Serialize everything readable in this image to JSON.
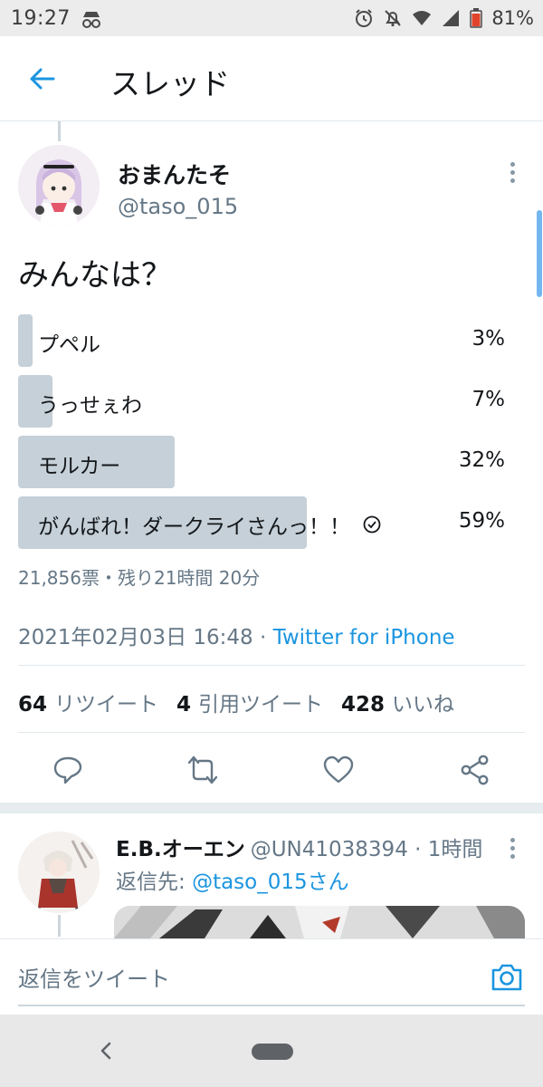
{
  "status_bar": {
    "time": "19:27",
    "battery_percent": "81%",
    "icons": [
      "incognito-icon",
      "alarm-icon",
      "notifications-off-icon",
      "wifi-icon",
      "signal-icon",
      "battery-icon"
    ]
  },
  "header": {
    "title": "スレッド",
    "back_icon": "arrow-left-icon"
  },
  "tweet": {
    "author_name": "おまんたそ",
    "author_handle": "@taso_015",
    "text": "みんなは？",
    "poll": {
      "options": [
        {
          "label": "プペル",
          "percent_text": "3%",
          "percent": 3,
          "selected": false
        },
        {
          "label": "うっせぇわ",
          "percent_text": "7%",
          "percent": 7,
          "selected": false
        },
        {
          "label": "モルカー",
          "percent_text": "32%",
          "percent": 32,
          "selected": false
        },
        {
          "label": "がんばれ！ダークライさんっ！！",
          "percent_text": "59%",
          "percent": 59,
          "selected": true
        }
      ],
      "meta": "21,856票・残り21時間 20分"
    },
    "timestamp": "2021年02月03日 16:48 · ",
    "source": "Twitter for iPhone",
    "stats": {
      "retweets_count": "64",
      "retweets_label": "リツイート",
      "quotes_count": "4",
      "quotes_label": "引用ツイート",
      "likes_count": "428",
      "likes_label": "いいね"
    }
  },
  "reply": {
    "author_name": "E.B.オーエン",
    "author_handle_time": "@UN41038394 · 1時間",
    "reply_to_prefix": "返信先: ",
    "reply_to_mention": "@taso_015さん"
  },
  "compose": {
    "placeholder": "返信をツイート"
  },
  "colors": {
    "accent": "#1b95e0",
    "poll_fill": "#c5d0d8",
    "secondary_text": "#657786"
  }
}
